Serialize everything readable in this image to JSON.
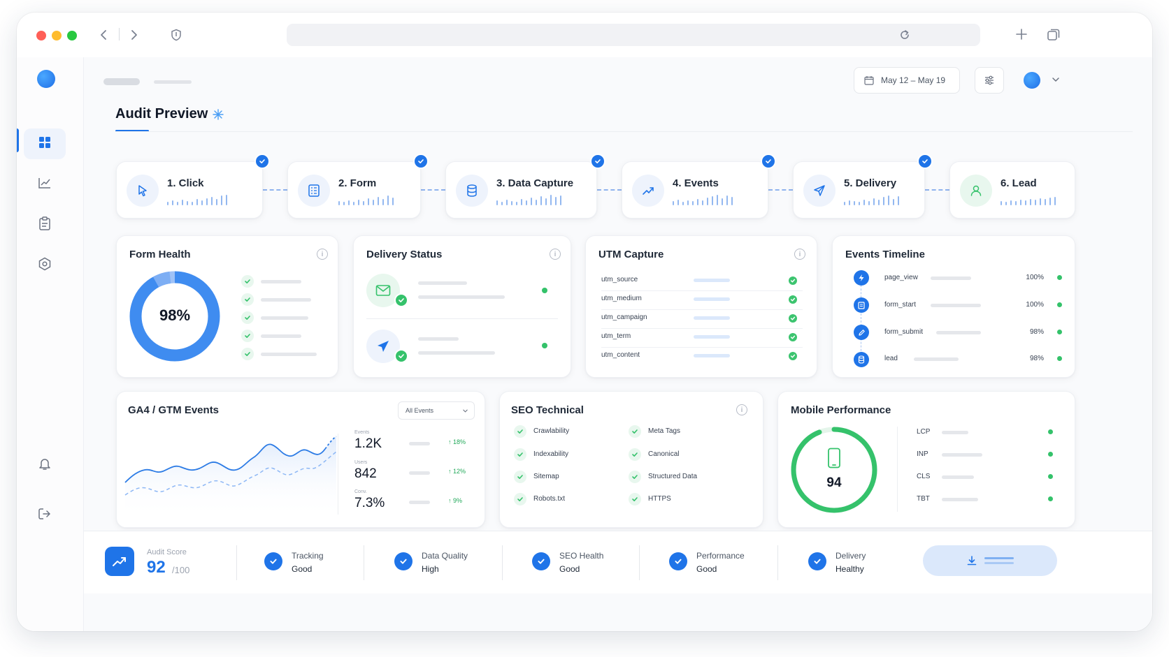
{
  "header": {
    "title": "Audit Preview",
    "date_range": "May 12 – May 19"
  },
  "steps": [
    {
      "label": "1. Click",
      "icon": "cursor-icon",
      "color": "#1f74e8"
    },
    {
      "label": "2. Form",
      "icon": "form-icon",
      "color": "#1f74e8"
    },
    {
      "label": "3. Data Capture",
      "icon": "database-icon",
      "color": "#1f74e8"
    },
    {
      "label": "4. Events",
      "icon": "trend-icon",
      "color": "#1f74e8"
    },
    {
      "label": "5. Delivery",
      "icon": "send-icon",
      "color": "#1f74e8"
    },
    {
      "label": "6. Lead",
      "icon": "user-icon",
      "color": "#35c26b"
    }
  ],
  "form_health": {
    "title": "Form Health",
    "value": "98%",
    "progress": 0.98
  },
  "delivery_status": {
    "title": "Delivery Status"
  },
  "utm_capture": {
    "title": "UTM Capture",
    "rows": [
      "utm_source",
      "utm_medium",
      "utm_campaign",
      "utm_term",
      "utm_content"
    ]
  },
  "events_timeline": {
    "title": "Events Timeline",
    "rows": [
      {
        "name": "page_view",
        "pct": "100%"
      },
      {
        "name": "form_start",
        "pct": "100%"
      },
      {
        "name": "form_submit",
        "pct": "98%"
      },
      {
        "name": "lead",
        "pct": "98%"
      }
    ]
  },
  "ga4": {
    "title": "GA4 / GTM Events",
    "filter": "All Events",
    "stats": [
      {
        "label": "Events",
        "value": "1.2K",
        "change": "↑ 18%"
      },
      {
        "label": "Users",
        "value": "842",
        "change": "↑ 12%"
      },
      {
        "label": "Conv.",
        "value": "7.3%",
        "change": "↑ 9%"
      }
    ]
  },
  "seo": {
    "title": "SEO Technical",
    "left": [
      "Crawlability",
      "Indexability",
      "Sitemap",
      "Robots.txt"
    ],
    "right": [
      "Meta Tags",
      "Canonical",
      "Structured Data",
      "HTTPS"
    ]
  },
  "mobile": {
    "title": "Mobile Performance",
    "score": "94",
    "progress": 0.94,
    "metrics": [
      "LCP",
      "INP",
      "CLS",
      "TBT"
    ]
  },
  "footer": {
    "score_label": "Audit Score",
    "score_value": "92",
    "score_max": "/100",
    "items": [
      {
        "title": "Tracking",
        "value": "Good"
      },
      {
        "title": "Data Quality",
        "value": "High"
      },
      {
        "title": "SEO Health",
        "value": "Good"
      },
      {
        "title": "Performance",
        "value": "Good"
      },
      {
        "title": "Delivery",
        "value": "Healthy"
      }
    ]
  },
  "colors": {
    "accent": "#1f74e8",
    "success": "#35c26b"
  }
}
